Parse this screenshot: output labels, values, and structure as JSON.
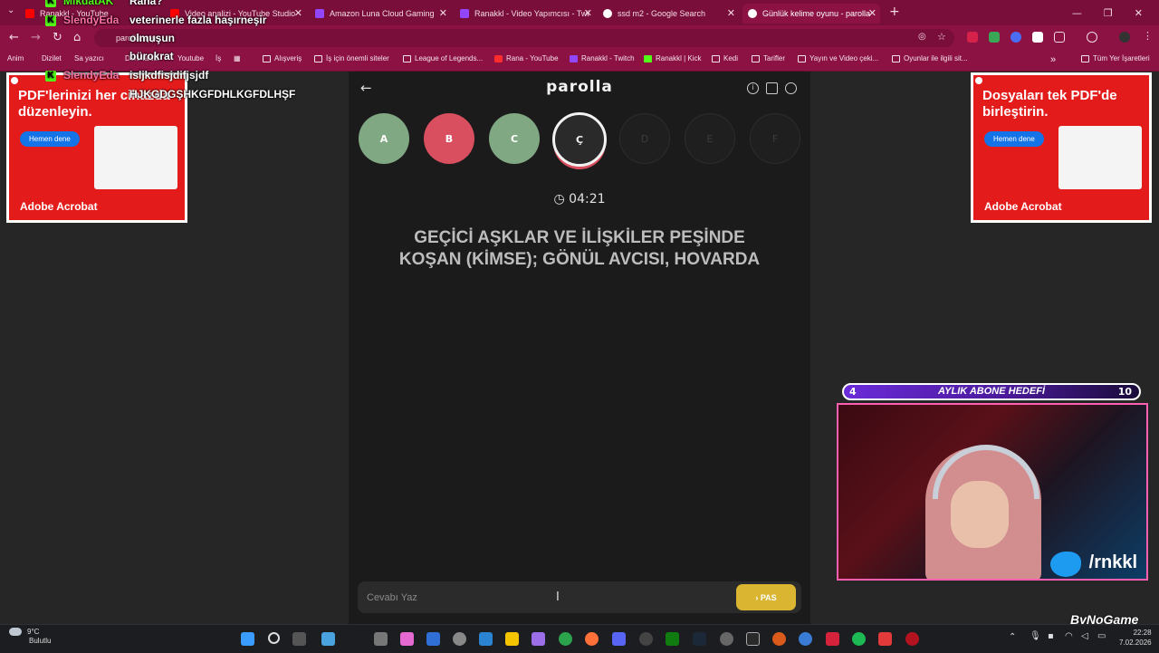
{
  "browser": {
    "tabs": [
      {
        "label": "Ranakkl - YouTube",
        "active": false
      },
      {
        "label": "Video analizi - YouTube Studio",
        "active": false
      },
      {
        "label": "Amazon Luna Cloud Gaming",
        "active": false
      },
      {
        "label": "Ranakkl - Video Yapımcısı - Twi",
        "active": false
      },
      {
        "label": "ssd m2 - Google Search",
        "active": false
      },
      {
        "label": "Günlük kelime oyunu - parolla",
        "active": true
      }
    ],
    "url": "parolla.app",
    "bookmarks": [
      "Anim",
      "Dizilet",
      "Sa yazıcı",
      "Ders takibi",
      "Youtube",
      "İş",
      "Alışveriş",
      "İş için önemli siteler",
      "League of Legends...",
      "Rana - YouTube",
      "Ranakkl - Twitch",
      "Ranakkl | Kick",
      "Kedi",
      "Tarifler",
      "Yayın ve Video çeki...",
      "Oyunlar ile ilgili sit..."
    ],
    "all_bookmarks": "Tüm Yer İşaretleri"
  },
  "ads": {
    "left": {
      "text": "PDF'lerinizi her cihazda düzenleyin.",
      "button": "Hemen dene",
      "brand": "Adobe Acrobat"
    },
    "right": {
      "text": "Dosyaları tek PDF'de birleştirin.",
      "button": "Hemen dene",
      "brand": "Adobe Acrobat"
    }
  },
  "game": {
    "title": "parolla",
    "letters": [
      {
        "letter": "A",
        "state": "correct"
      },
      {
        "letter": "B",
        "state": "wrong"
      },
      {
        "letter": "C",
        "state": "correct"
      },
      {
        "letter": "Ç",
        "state": "current"
      },
      {
        "letter": "D",
        "state": "pending"
      },
      {
        "letter": "E",
        "state": "pending"
      },
      {
        "letter": "F",
        "state": "pending"
      }
    ],
    "timer": "04:21",
    "question": "GEÇİCİ AŞKLAR VE İLİŞKİLER PEŞİNDE KOŞAN (KİMSE); GÖNÜL AVCISI, HOVARDA",
    "answer_placeholder": "Cevabı Yaz",
    "pass_label": "PAS"
  },
  "chat": [
    {
      "user": "MikdatAK",
      "message": "Rana?",
      "color": "green"
    },
    {
      "user": "SlendyEda",
      "message": "veterinerle fazla haşırneşir",
      "color": "pink"
    },
    {
      "user": "",
      "message": "olmuşun",
      "color": "green"
    },
    {
      "user": "",
      "message": "bürokrat",
      "color": "green"
    },
    {
      "user": "SlendyEda",
      "message": "isljkdfisjdifjsjdf",
      "color": "pink"
    },
    {
      "user": "",
      "message": "HJKGDGŞHKGFDHLKGFDLHŞF",
      "color": "green"
    }
  ],
  "stream": {
    "goal_current": "4",
    "goal_label": "AYLIK ABONE HEDEFİ",
    "goal_target": "10",
    "handle": "/rnkkl",
    "watermark": "ByNoGame"
  },
  "taskbar": {
    "weather_temp": "9°C",
    "weather_desc": "Bulutlu",
    "time": "22:28",
    "date": "7.02.2026"
  }
}
